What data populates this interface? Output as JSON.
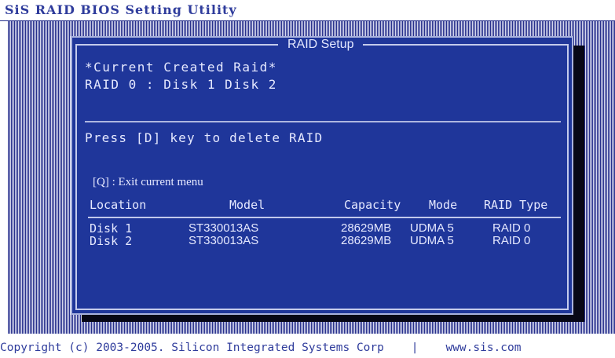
{
  "app": {
    "title": "SiS RAID BIOS Setting Utility"
  },
  "panel": {
    "title": "RAID Setup",
    "created_heading": "*Current Created Raid*",
    "raid_line": "RAID 0  : Disk 1   Disk 2",
    "delete_hint": "Press [D] key to delete RAID",
    "exit_hint": "[Q] : Exit current menu"
  },
  "table": {
    "columns": [
      "Location",
      "Model",
      "Capacity",
      "Mode",
      "RAID Type"
    ],
    "rows": [
      {
        "location": "Disk 1",
        "model": "ST330013AS",
        "capacity": "28629MB",
        "mode": "UDMA 5",
        "raid_type": "RAID 0"
      },
      {
        "location": "Disk 2",
        "model": "ST330013AS",
        "capacity": "28629MB",
        "mode": "UDMA 5",
        "raid_type": "RAID 0"
      }
    ]
  },
  "footer": {
    "copyright": "Copyright (c) 2003-2005. Silicon Integrated Systems Corp",
    "separator": "|",
    "website": "www.sis.com"
  },
  "colors": {
    "panel_background": "#1f369a",
    "text": "#e6e9ff",
    "brand_text": "#2f3c9c"
  }
}
